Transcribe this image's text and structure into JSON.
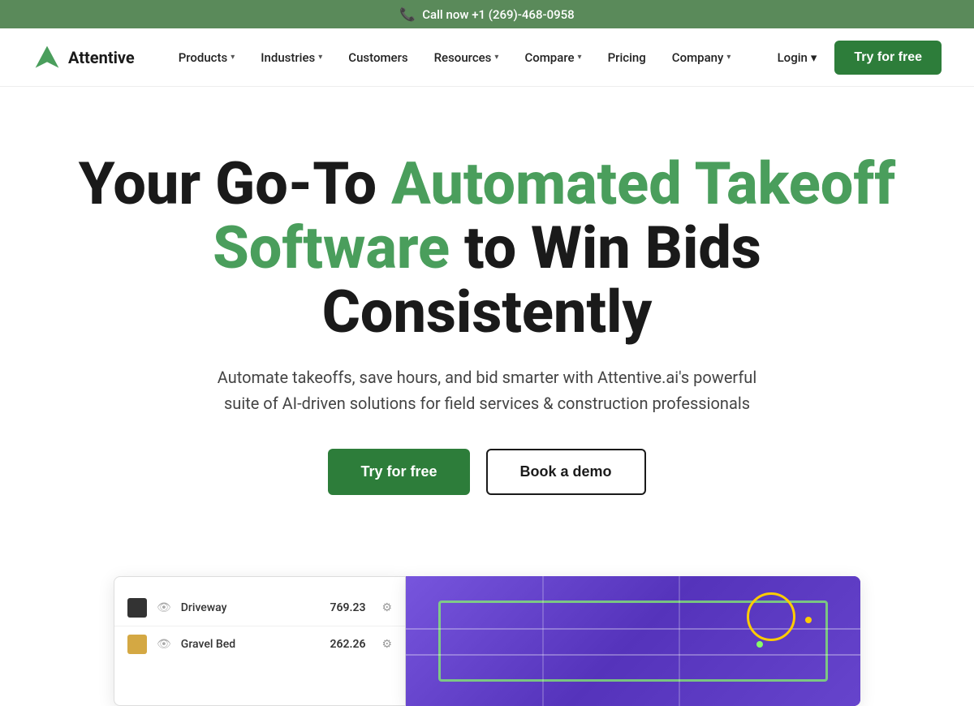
{
  "topbar": {
    "cta": "Call now +1 (269)-468-0958"
  },
  "nav": {
    "logo_text": "Attentive",
    "items": [
      {
        "label": "Products",
        "has_dropdown": true
      },
      {
        "label": "Industries",
        "has_dropdown": true
      },
      {
        "label": "Customers",
        "has_dropdown": false
      },
      {
        "label": "Resources",
        "has_dropdown": true
      },
      {
        "label": "Compare",
        "has_dropdown": true
      },
      {
        "label": "Pricing",
        "has_dropdown": false
      },
      {
        "label": "Company",
        "has_dropdown": true
      }
    ],
    "login_label": "Login",
    "try_free_label": "Try for free"
  },
  "hero": {
    "title_part1": "Your Go-To ",
    "title_green": "Automated Takeoff",
    "title_part2": "Software",
    "title_part3": " to Win Bids Consistently",
    "subtitle": "Automate takeoffs, save hours, and bid smarter with Attentive.ai's powerful suite of AI-driven solutions for field services & construction professionals",
    "cta_primary": "Try for free",
    "cta_secondary": "Book a demo"
  },
  "screenshot": {
    "panel_rows": [
      {
        "label": "Driveway",
        "value": "769.23",
        "swatch": "dark"
      },
      {
        "label": "Gravel Bed",
        "value": "262.26",
        "swatch": "yellow"
      }
    ]
  },
  "colors": {
    "topbar_bg": "#5a8a5a",
    "green_accent": "#4a9e5c",
    "cta_bg": "#2d7d3a"
  }
}
